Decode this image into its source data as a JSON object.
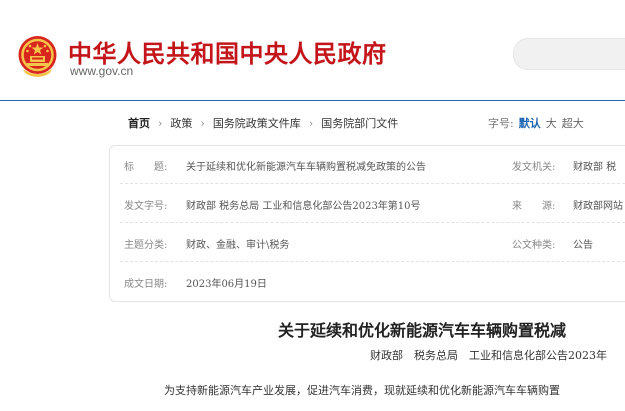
{
  "header": {
    "site_name": "中华人民共和国中央人民政府",
    "site_url": "www.gov.cn",
    "search_placeholder": ""
  },
  "breadcrumb": [
    "首页",
    "政策",
    "国务院政策文件库",
    "国务院部门文件"
  ],
  "font_size": {
    "label": "字号:",
    "options": [
      "默认",
      "大",
      "超大"
    ],
    "selected": "默认"
  },
  "info": {
    "title_label": "标　　题:",
    "title_value": "关于延续和优化新能源汽车车辆购置税减免政策的公告",
    "issuer_label": "发文机关:",
    "issuer_value": "财政部 税",
    "doc_no_label": "发文字号:",
    "doc_no_value": "财政部 税务总局 工业和信息化部公告2023年第10号",
    "source_label": "来　　源:",
    "source_value": "财政部网站",
    "topic_label": "主题分类:",
    "topic_value": "财政、金融、审计\\税务",
    "type_label": "公文种类:",
    "type_value": "公告",
    "date_label": "成文日期:",
    "date_value": "2023年06月19日"
  },
  "document": {
    "title": "关于延续和优化新能源汽车车辆购置税减",
    "number": "财政部　税务总局　工业和信息化部公告2023年",
    "body_start": "为支持新能源汽车产业发展，促进汽车消费，现就延续和优化新能源汽车车辆购置"
  },
  "colors": {
    "brand_red": "#c3151a",
    "link_blue": "#1f66b0"
  }
}
